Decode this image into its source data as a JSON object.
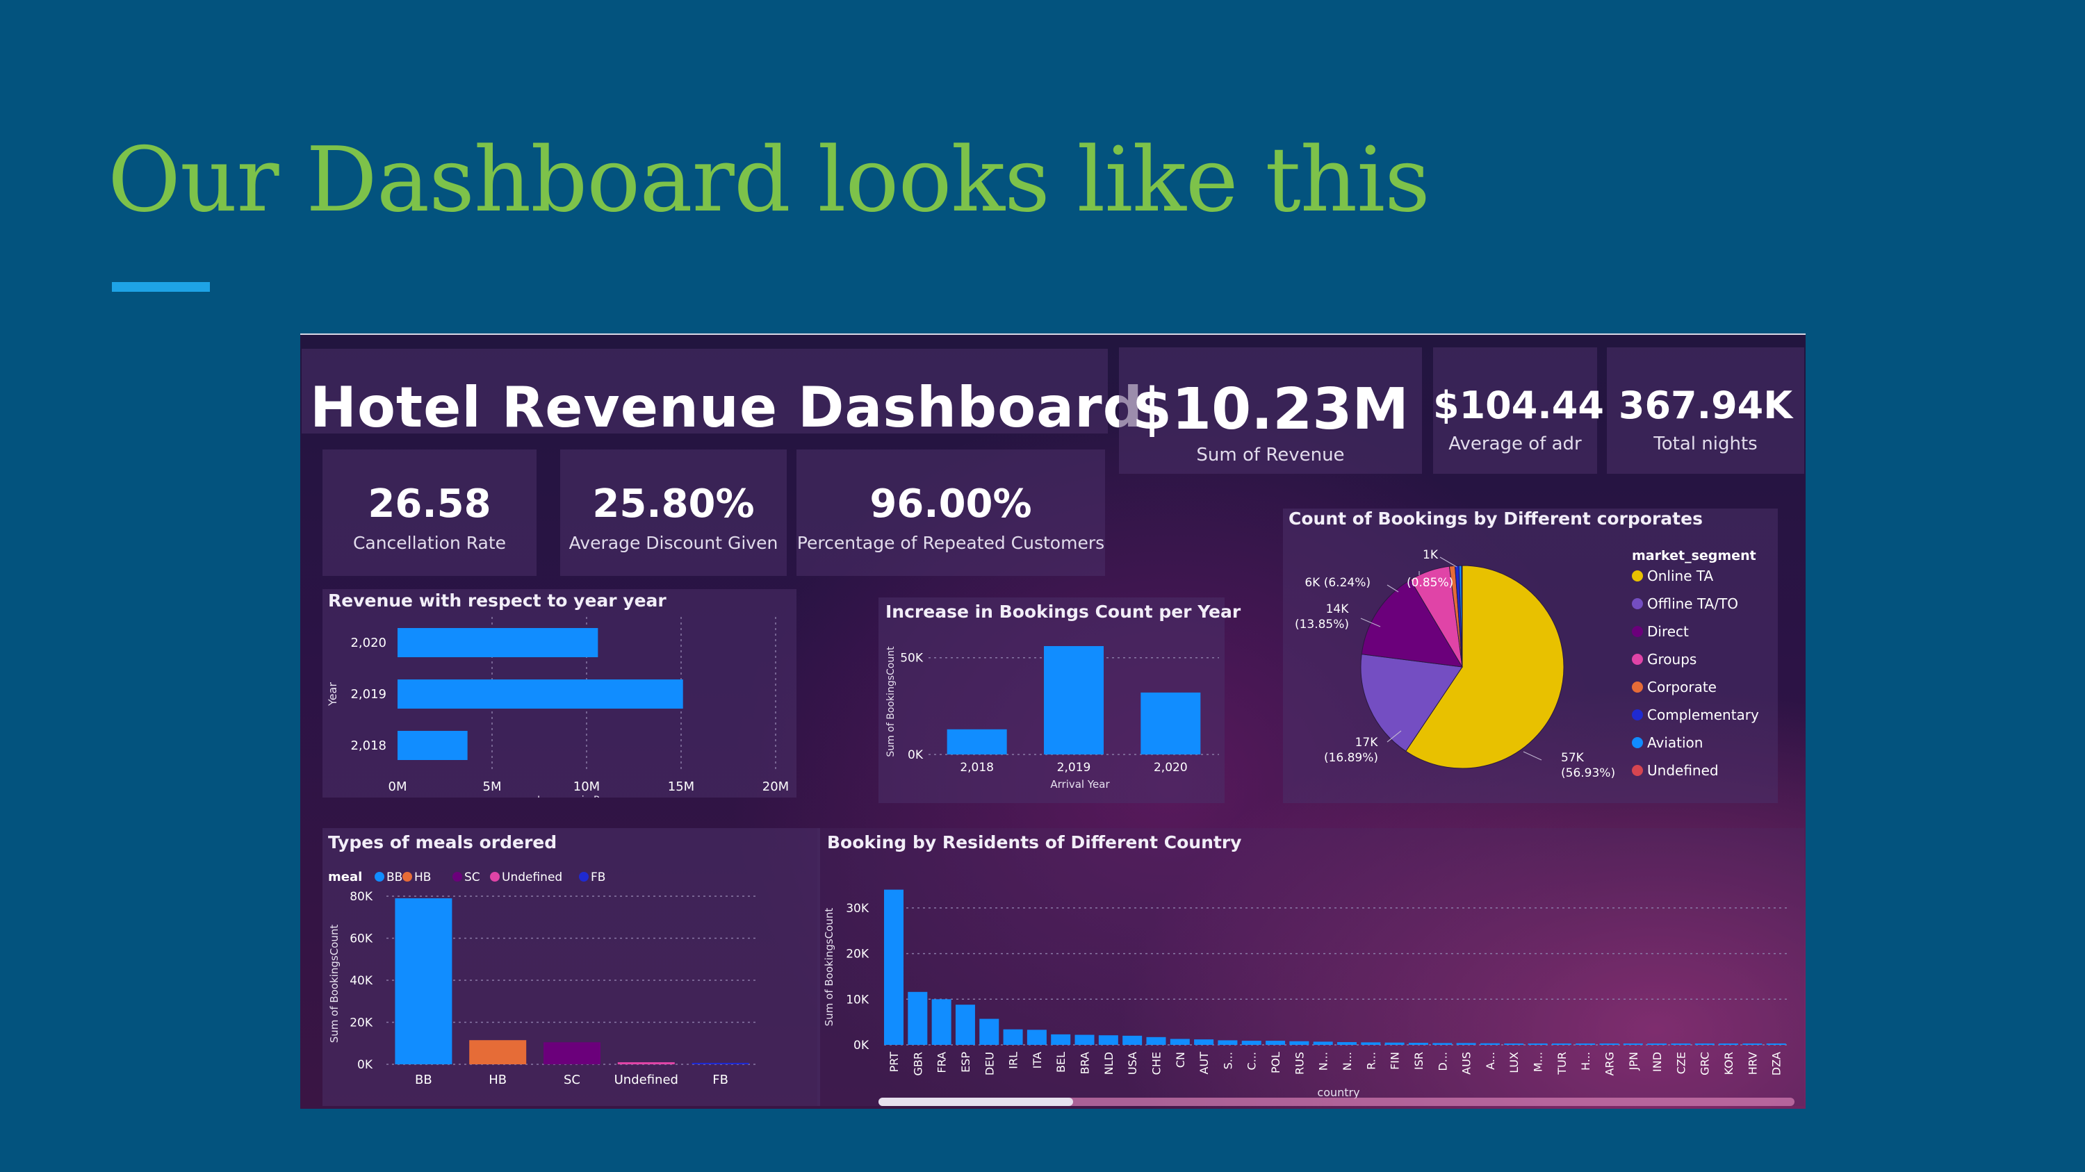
{
  "slide": {
    "title": "Our Dashboard looks like this"
  },
  "dashboard": {
    "title": "Hotel Revenue Dashboard"
  },
  "kpis": {
    "revenue": {
      "value": "$10.23M",
      "label": "Sum of Revenue"
    },
    "adr": {
      "value": "$104.44",
      "label": "Average of adr"
    },
    "nights": {
      "value": "367.94K",
      "label": "Total nights"
    },
    "cancellation": {
      "value": "26.58",
      "label": "Cancellation Rate"
    },
    "discount": {
      "value": "25.80%",
      "label": "Average Discount Given"
    },
    "repeated": {
      "value": "96.00%",
      "label": "Percentage of Repeated Customers"
    }
  },
  "colors": {
    "bar_blue": "#118dff",
    "meal_hb": "#e66c37",
    "meal_sc": "#6b007b",
    "meal_undefined": "#e044a7",
    "meal_fb": "#1f2ad1"
  },
  "chart_data": [
    {
      "id": "revenue_by_year",
      "type": "bar",
      "orientation": "horizontal",
      "title": "Revenue with respect to year year",
      "xlabel": "Increase in Revenue",
      "ylabel": "Year",
      "categories": [
        "2,020",
        "2,019",
        "2,018"
      ],
      "values": [
        10.6,
        15.1,
        3.7
      ],
      "xlim": [
        0,
        20
      ],
      "xticks": [
        "0M",
        "5M",
        "10M",
        "15M",
        "20M"
      ],
      "grid": true
    },
    {
      "id": "bookings_per_year",
      "type": "bar",
      "title": "Increase in Bookings Count per Year",
      "xlabel": "Arrival Year",
      "ylabel": "Sum of BookingsCount",
      "categories": [
        "2,018",
        "2,019",
        "2,020"
      ],
      "values": [
        13000,
        56000,
        32000
      ],
      "ylim": [
        0,
        56000
      ],
      "yticks": [
        "0K",
        "50K"
      ],
      "grid": true
    },
    {
      "id": "bookings_by_segment",
      "type": "pie",
      "title": "Count of Bookings by Different corporates",
      "legend_title": "market_segment",
      "legend": [
        "Online TA",
        "Offline TA/TO",
        "Direct",
        "Groups",
        "Corporate",
        "Complementary",
        "Aviation",
        "Undefined"
      ],
      "legend_colors": [
        "#e8c100",
        "#744ec2",
        "#6b007b",
        "#e044a7",
        "#e66c37",
        "#1f2ad1",
        "#118dff",
        "#d64550"
      ],
      "values": [
        56.93,
        16.89,
        13.85,
        6.24,
        0.85,
        0.6,
        0.4,
        0.1
      ],
      "data_labels": [
        {
          "count": "57K",
          "pct": "(56.93%)"
        },
        {
          "count": "17K",
          "pct": "(16.89%)"
        },
        {
          "count": "14K",
          "pct": "(13.85%)"
        },
        {
          "count": "6K (6.24%)",
          "pct": ""
        },
        {
          "count": "",
          "pct": "(0.85%)"
        },
        {
          "count": "1K",
          "pct": ""
        }
      ]
    },
    {
      "id": "meals",
      "type": "bar",
      "title": "Types of meals ordered",
      "legend_title": "meal",
      "legend": [
        "BB",
        "HB",
        "SC",
        "Undefined",
        "FB"
      ],
      "ylabel": "Sum of BookingsCount",
      "categories": [
        "BB",
        "HB",
        "SC",
        "Undefined",
        "FB"
      ],
      "values": [
        79000,
        11500,
        10500,
        1000,
        700
      ],
      "ylim": [
        0,
        80000
      ],
      "yticks": [
        "0K",
        "20K",
        "40K",
        "60K",
        "80K"
      ],
      "grid": true
    },
    {
      "id": "country",
      "type": "bar",
      "title": "Booking by Residents of Different Country",
      "xlabel": "country",
      "ylabel": "Sum of BookingsCount",
      "categories": [
        "PRT",
        "GBR",
        "FRA",
        "ESP",
        "DEU",
        "IRL",
        "ITA",
        "BEL",
        "BRA",
        "NLD",
        "USA",
        "CHE",
        "CN",
        "AUT",
        "S...",
        "C...",
        "POL",
        "RUS",
        "N...",
        "N...",
        "R...",
        "FIN",
        "ISR",
        "D...",
        "AUS",
        "A...",
        "LUX",
        "M...",
        "TUR",
        "H...",
        "ARG",
        "JPN",
        "IND",
        "CZE",
        "GRC",
        "KOR",
        "HRV",
        "DZA"
      ],
      "values": [
        34000,
        11600,
        10000,
        8800,
        5700,
        3400,
        3300,
        2300,
        2200,
        2100,
        2000,
        1700,
        1300,
        1200,
        1000,
        900,
        900,
        800,
        700,
        600,
        550,
        500,
        450,
        400,
        400,
        350,
        300,
        300,
        280,
        260,
        240,
        230,
        220,
        200,
        190,
        180,
        170,
        160
      ],
      "ylim": [
        0,
        35000
      ],
      "yticks": [
        "0K",
        "10K",
        "20K",
        "30K"
      ],
      "grid": true
    }
  ]
}
